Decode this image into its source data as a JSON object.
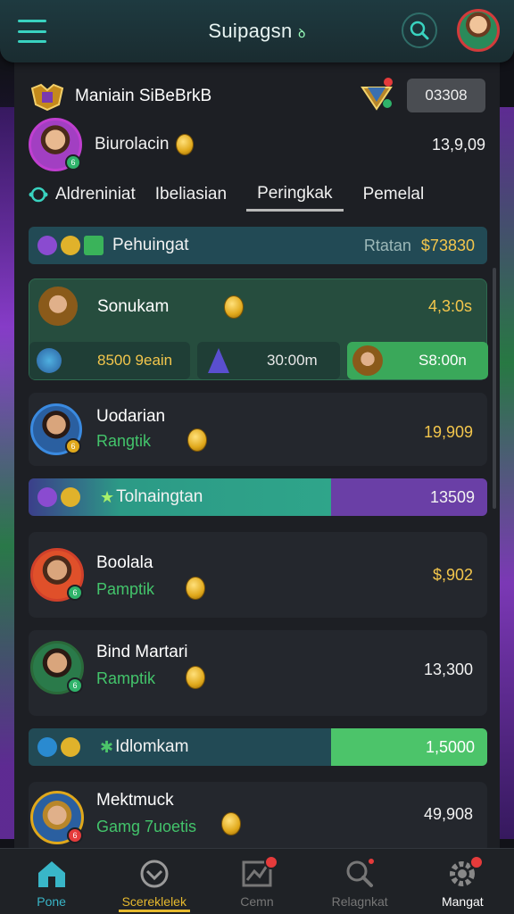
{
  "header": {
    "title": "Suipagsn",
    "title_suffix": "ꝺ"
  },
  "group": {
    "name": "Maniain SiBeBrkB",
    "score": "03308"
  },
  "me": {
    "name": "Biurolacin",
    "score": "13,9,09"
  },
  "tabs": [
    {
      "label": "Aldreniniat"
    },
    {
      "label": "Ibeliasian"
    },
    {
      "label": "Peringkak",
      "active": true
    },
    {
      "label": "Pemelal"
    }
  ],
  "rows": {
    "banner1": {
      "label": "Pehuingat",
      "right_label": "Rtatan",
      "right_value": "$73830"
    },
    "top_card": {
      "name": "Sonukam",
      "score": "4,3:0s",
      "tiles": [
        {
          "value": "8500 9eain"
        },
        {
          "value": "30:00m"
        },
        {
          "value": "S8:00n"
        }
      ]
    },
    "player1": {
      "name": "Uodarian",
      "sub": "Rangtik",
      "score": "19,909"
    },
    "banner2": {
      "label": "Tolnaingtan",
      "value": "13509"
    },
    "player2": {
      "name": "Boolala",
      "sub": "Pamptik",
      "score": "$,902"
    },
    "player3": {
      "name": "Bind Martari",
      "sub": "Ramptik",
      "score": "13,300"
    },
    "banner3": {
      "label": "Idlomkam",
      "value": "1,5000"
    },
    "player4": {
      "name": "Mektmuck",
      "sub": "Gamg 7uoetis",
      "score": "49,908"
    }
  },
  "bottom_nav": [
    {
      "label": "Pone",
      "icon": "home-icon",
      "color": "#39b6c8"
    },
    {
      "label": "Scereklelek",
      "icon": "shield-icon",
      "color": "#e6b92e"
    },
    {
      "label": "Cemn",
      "icon": "chart-icon",
      "color": "#777777"
    },
    {
      "label": "Relagnkat",
      "icon": "search-icon",
      "color": "#777777"
    },
    {
      "label": "Mangat",
      "icon": "gear-icon",
      "color": "#ffffff"
    }
  ],
  "colors": {
    "accent": "#39d3c0",
    "green": "#43c46b",
    "gold": "#f3c64c",
    "purple": "#6a3fa6"
  }
}
